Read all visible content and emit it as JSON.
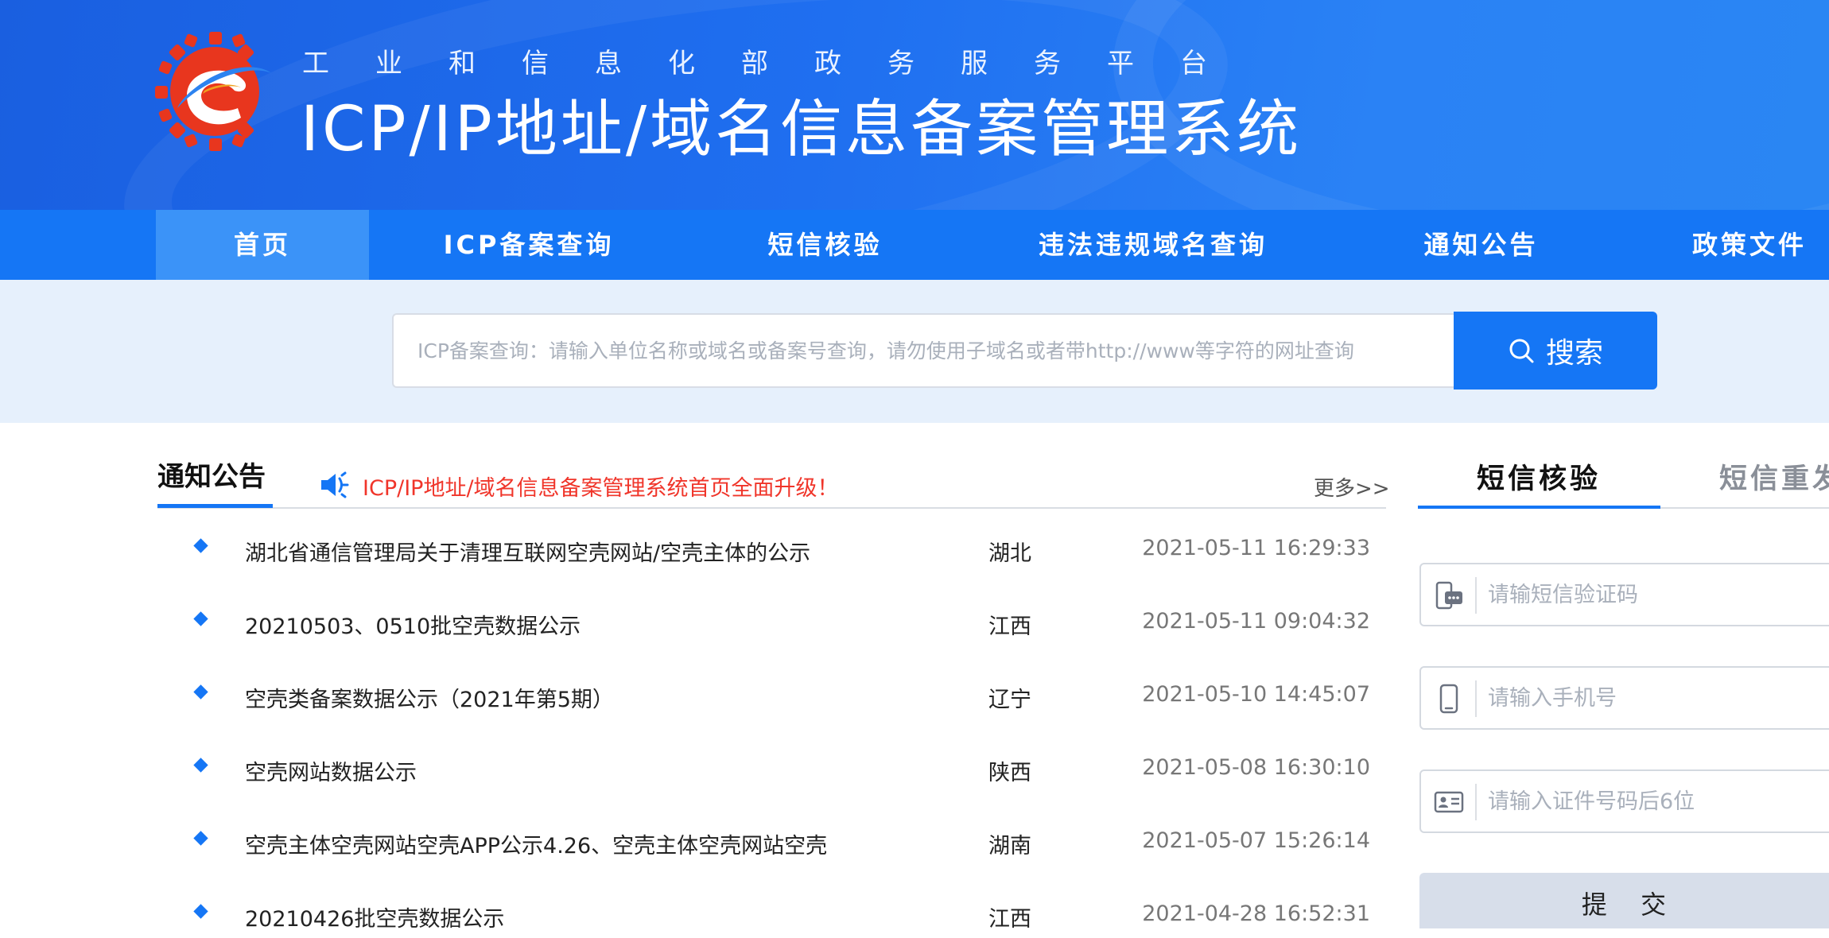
{
  "header": {
    "subtitle": "工业和信息化部政务服务平台",
    "title": "ICP/IP地址/域名信息备案管理系统"
  },
  "nav": {
    "items": [
      {
        "label": "首页",
        "active": true
      },
      {
        "label": "ICP备案查询",
        "active": false
      },
      {
        "label": "短信核验",
        "active": false
      },
      {
        "label": "违法违规域名查询",
        "active": false
      },
      {
        "label": "通知公告",
        "active": false
      },
      {
        "label": "政策文件",
        "active": false
      }
    ]
  },
  "search": {
    "placeholder": "ICP备案查询：请输入单位名称或域名或备案号查询，请勿使用子域名或者带http://www等字符的网址查询",
    "button_label": "搜索"
  },
  "notice": {
    "tab_label": "通知公告",
    "marquee": "ICP/IP地址/域名信息备案管理系统首页全面升级！",
    "more_label": "更多>>",
    "rows": [
      {
        "title": "湖北省通信管理局关于清理互联网空壳网站/空壳主体的公示",
        "region": "湖北",
        "time": "2021-05-11 16:29:33"
      },
      {
        "title": "20210503、0510批空壳数据公示",
        "region": "江西",
        "time": "2021-05-11 09:04:32"
      },
      {
        "title": "空壳类备案数据公示（2021年第5期）",
        "region": "辽宁",
        "time": "2021-05-10 14:45:07"
      },
      {
        "title": "空壳网站数据公示",
        "region": "陕西",
        "time": "2021-05-08 16:30:10"
      },
      {
        "title": "空壳主体空壳网站空壳APP公示4.26、空壳主体空壳网站空壳",
        "region": "湖南",
        "time": "2021-05-07 15:26:14"
      },
      {
        "title": "20210426批空壳数据公示",
        "region": "江西",
        "time": "2021-04-28 16:52:31"
      }
    ]
  },
  "sms": {
    "tabs": [
      {
        "label": "短信核验",
        "active": true
      },
      {
        "label": "短信重发",
        "active": false
      }
    ],
    "code_placeholder": "请输短信验证码",
    "phone_placeholder": "请输入手机号",
    "id_placeholder": "请输入证件号码后6位",
    "submit_label": "提 交"
  },
  "colors": {
    "primary": "#1576f5",
    "nav_active": "#3b93f8",
    "marquee": "#f0352a",
    "search_band": "#e6f0fc"
  }
}
